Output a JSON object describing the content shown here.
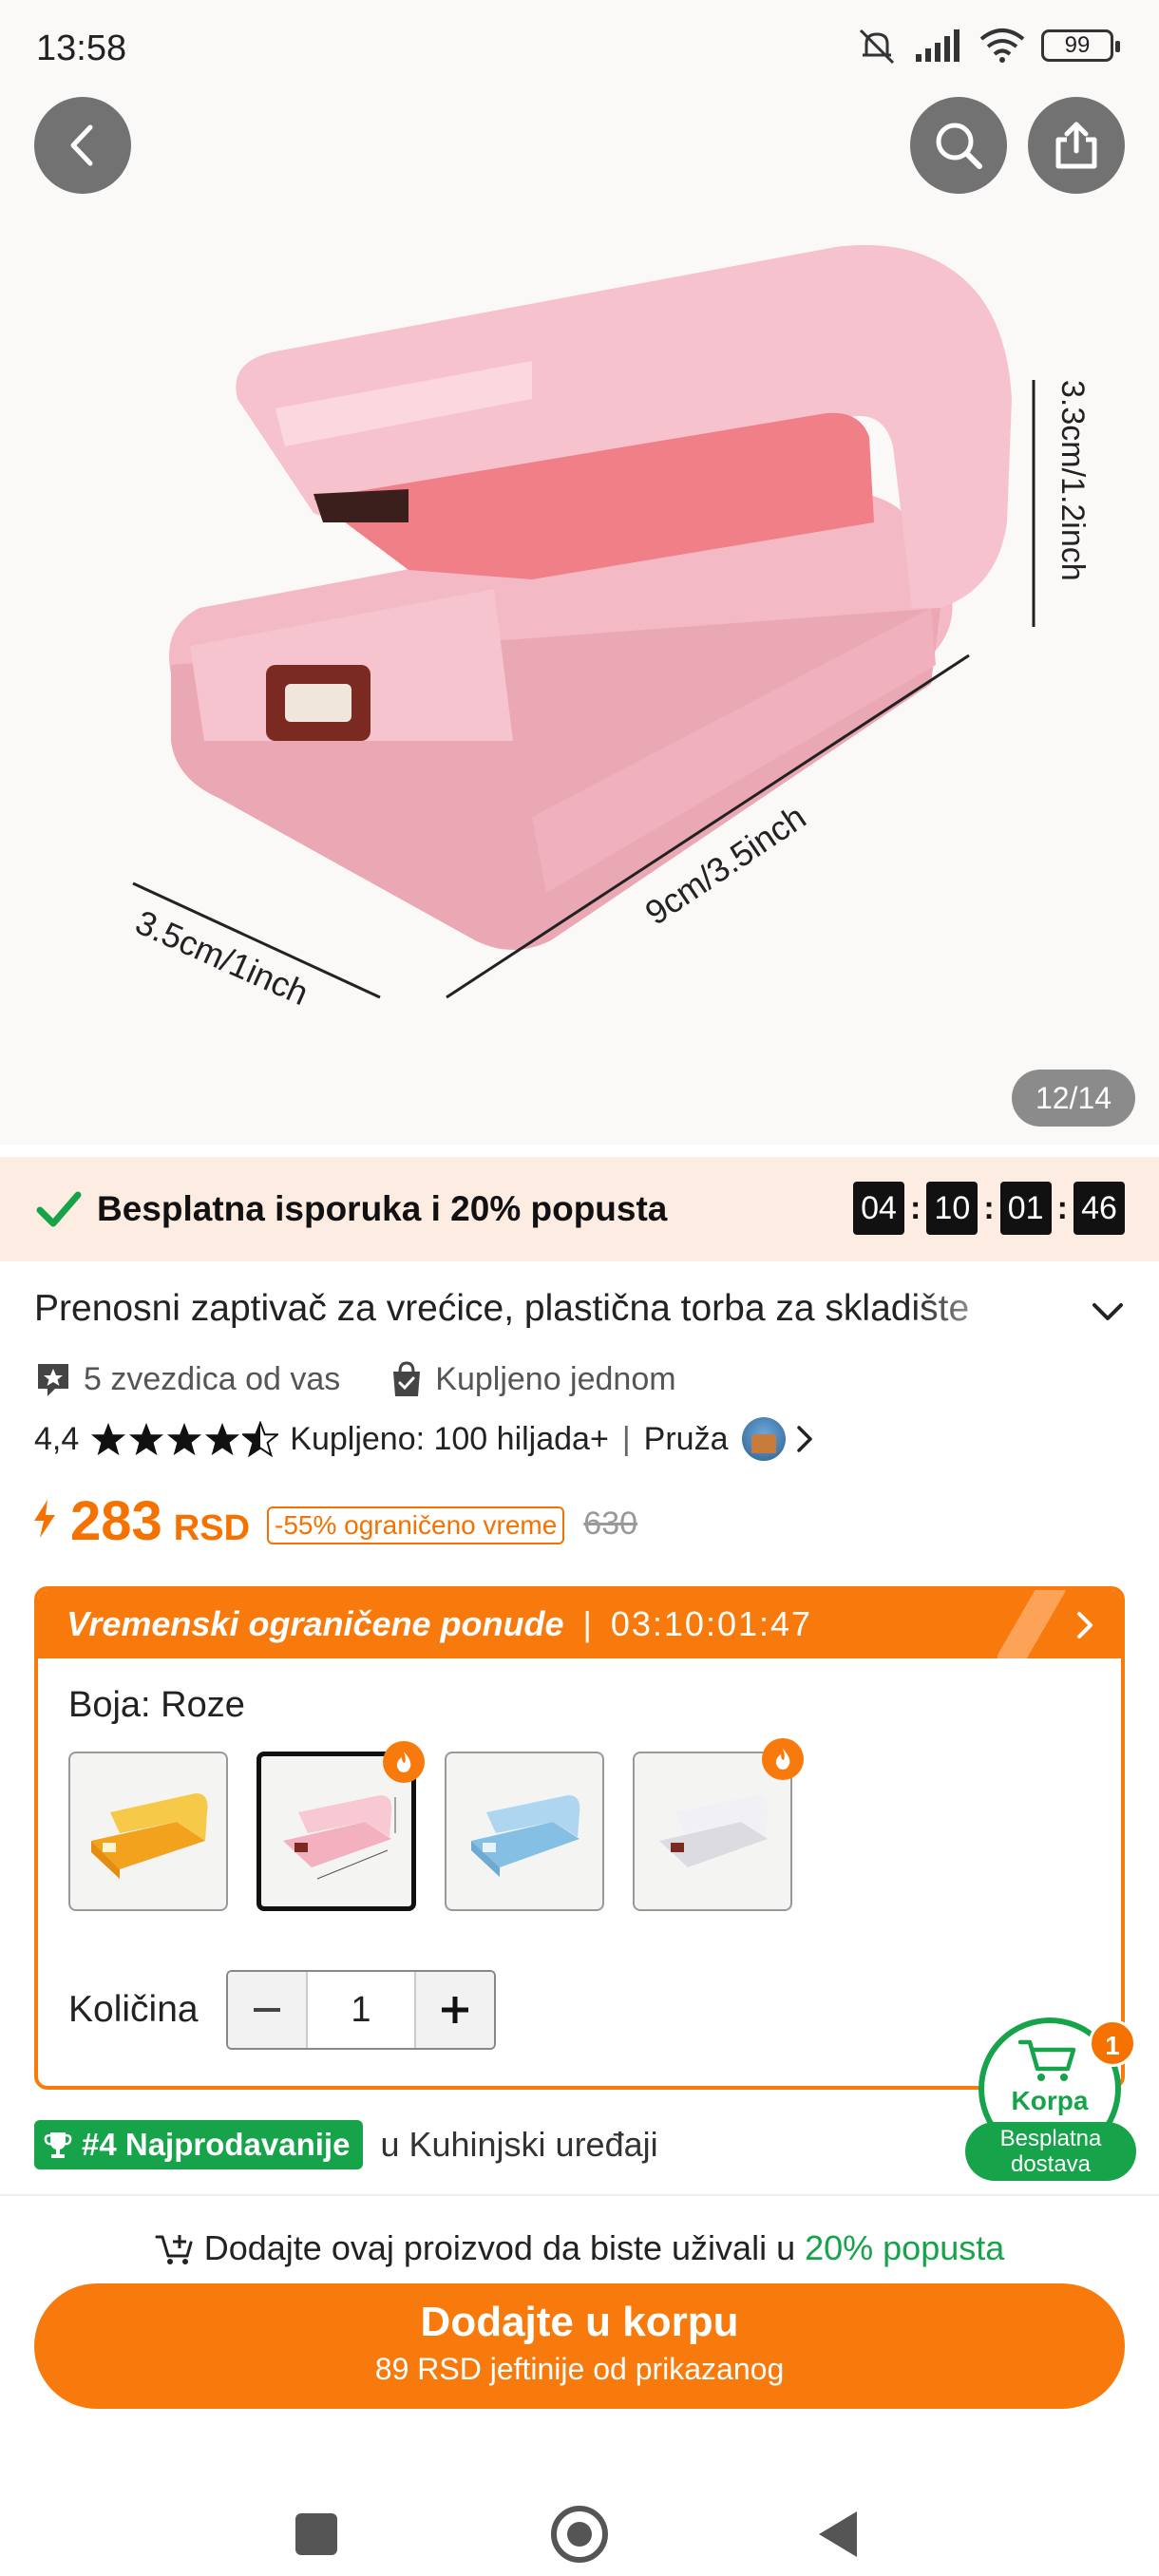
{
  "status_bar": {
    "time": "13:58",
    "battery": "99"
  },
  "gallery": {
    "page_indicator": "12/14",
    "dimension_height": "3.3cm/1.2inch",
    "dimension_length": "9cm/3.5inch",
    "dimension_width": "3.5cm/1inch"
  },
  "promo": {
    "text": "Besplatna isporuka i 20% popusta",
    "timer": [
      "04",
      "10",
      "01",
      "46"
    ]
  },
  "product": {
    "title": "Prenosni zaptivač za vrećice, plastična torba za skladište",
    "review_badge": "5 zvezdica od vas",
    "purchase_badge": "Kupljeno jednom",
    "rating": "4,4",
    "sold": "Kupljeno: 100 hiljada+",
    "provider_label": "Pruža"
  },
  "price": {
    "value": "283",
    "currency": "RSD",
    "discount": "-55% ograničeno vreme",
    "old": "630"
  },
  "offer": {
    "title": "Vremenski ograničene ponude",
    "timer": "03:10:01:47",
    "color_label": "Boja: Roze",
    "swatches": [
      {
        "name": "yellow",
        "color": "#f5b52e",
        "hot": false
      },
      {
        "name": "pink",
        "color": "#f6b8c6",
        "hot": true
      },
      {
        "name": "blue",
        "color": "#9cc9e8",
        "hot": false
      },
      {
        "name": "white",
        "color": "#ecebef",
        "hot": true
      }
    ],
    "quantity_label": "Količina",
    "quantity": "1"
  },
  "cart": {
    "label": "Korpa",
    "count": "1",
    "delivery": "Besplatna dostava"
  },
  "bestseller": {
    "badge": "#4 Najprodavanije",
    "category": "u Kuhinjski uređaji"
  },
  "bottom": {
    "hint_prefix": "Dodajte ovaj proizvod da biste uživali u",
    "hint_highlight": "20% popusta",
    "button_main": "Dodajte u korpu",
    "button_sub": "89 RSD jeftinije od prikazanog"
  },
  "colors": {
    "accent": "#f97a0c",
    "price": "#f57200",
    "green": "#16a34a"
  }
}
